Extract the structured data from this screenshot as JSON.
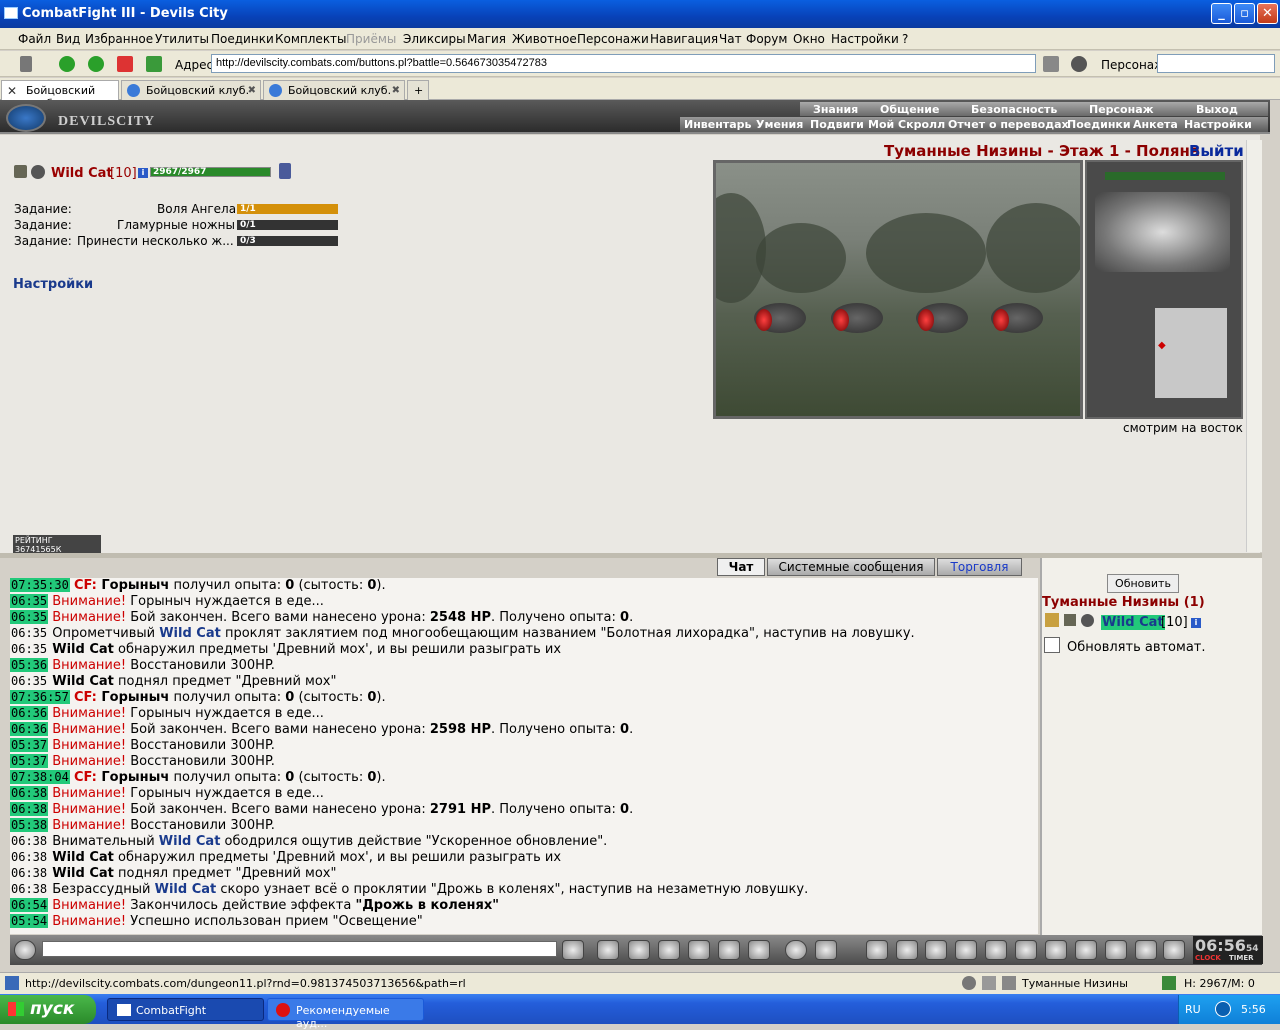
{
  "window": {
    "title": "CombatFight III - Devils City"
  },
  "menu": [
    "Файл",
    "Вид",
    "Избранное",
    "Утилиты",
    "Поединки",
    "Комплекты",
    "Приёмы",
    "Эликсиры",
    "Магия",
    "Животное",
    "Персонажи",
    "Навигация",
    "Чат",
    "Форум",
    "Окно",
    "Настройки",
    "?"
  ],
  "address": {
    "label": "Адрес:",
    "url": "http://devilscity.combats.com/buttons.pl?battle=0.564673035472783",
    "persona_label": "Персонаж:"
  },
  "tabs": [
    {
      "label": "Бойцовский клуб"
    },
    {
      "label": "Бойцовский клуб."
    },
    {
      "label": "Бойцовский клуб."
    }
  ],
  "game_header": {
    "logo": "DEVILSCITY",
    "nav_top": [
      "Знания",
      "Общение",
      "Безопасность",
      "Персонаж",
      "Выход"
    ],
    "nav_bottom": [
      "Инвентарь",
      "Умения",
      "Подвиги",
      "Мой Скролл",
      "Отчет о переводах",
      "Поединки",
      "Анкета",
      "Настройки"
    ]
  },
  "character": {
    "name": "Wild Cat",
    "level": "[10]",
    "hp": "2967/2967",
    "hp_fraction": 1.0
  },
  "quests": [
    {
      "label": "Задание:",
      "name": "Воля Ангела",
      "progress": "1/1",
      "fraction": 1.0
    },
    {
      "label": "Задание:",
      "name": "Гламурные ножны",
      "progress": "0/1",
      "fraction": 0
    },
    {
      "label": "Задание:",
      "name": "Принести несколько ж...",
      "progress": "0/3",
      "fraction": 0
    }
  ],
  "settings_link": "Настройки",
  "location": {
    "title": "Туманные Низины - Этаж 1 - Поляна",
    "exit": "Выйти",
    "facing": "смотрим на восток"
  },
  "rating": "РЕЙТИНГ 36741565К",
  "chat_tabs": [
    "Чат",
    "Системные сообщения",
    "Торговля"
  ],
  "chat": [
    {
      "ts": "07:35:30",
      "hl": true,
      "parts": [
        [
          "cf",
          "CF:"
        ],
        [
          "b",
          " Горыныч"
        ],
        [
          "",
          "",
          " получил опыта: "
        ],
        [
          "b",
          "0"
        ],
        [
          "",
          " (сытость: "
        ],
        [
          "b",
          "0"
        ],
        [
          "",
          "). "
        ]
      ]
    },
    {
      "ts": "06:35",
      "hl": true,
      "parts": [
        [
          "warn",
          "Внимание!"
        ],
        [
          "",
          " Горыныч нуждается в еде..."
        ]
      ]
    },
    {
      "ts": "06:35",
      "hl": true,
      "parts": [
        [
          "warn",
          "Внимание!"
        ],
        [
          "",
          " Бой закончен. Всего вами нанесено урона: "
        ],
        [
          "b",
          "2548 HP"
        ],
        [
          "",
          ". Получено опыта: "
        ],
        [
          "b",
          "0"
        ],
        [
          "",
          "."
        ]
      ]
    },
    {
      "ts": "06:35",
      "hl": false,
      "parts": [
        [
          "",
          "Опрометчивый "
        ],
        [
          "nm",
          "Wild Cat"
        ],
        [
          "",
          " проклят заклятием под многообещающим названием \"Болотная лихорадка\", наступив на ловушку."
        ]
      ]
    },
    {
      "ts": "06:35",
      "hl": false,
      "parts": [
        [
          "b",
          "Wild Cat"
        ],
        [
          "",
          " обнаружил предметы 'Древний мох', и вы решили разыграть их"
        ]
      ]
    },
    {
      "ts": "05:36",
      "hl": true,
      "parts": [
        [
          "warn",
          "Внимание!"
        ],
        [
          "",
          " Восстановили 300HP."
        ]
      ]
    },
    {
      "ts": "06:35",
      "hl": false,
      "parts": [
        [
          "b",
          "Wild Cat"
        ],
        [
          "",
          " поднял предмет \"Древний мох\""
        ]
      ]
    },
    {
      "ts": "07:36:57",
      "hl": true,
      "parts": [
        [
          "cf",
          "CF:"
        ],
        [
          "b",
          " Горыныч"
        ],
        [
          "",
          " получил опыта: "
        ],
        [
          "b",
          "0"
        ],
        [
          "",
          " (сытость: "
        ],
        [
          "b",
          "0"
        ],
        [
          "",
          "). "
        ]
      ]
    },
    {
      "ts": "06:36",
      "hl": true,
      "parts": [
        [
          "warn",
          "Внимание!"
        ],
        [
          "",
          " Горыныч нуждается в еде..."
        ]
      ]
    },
    {
      "ts": "06:36",
      "hl": true,
      "parts": [
        [
          "warn",
          "Внимание!"
        ],
        [
          "",
          " Бой закончен. Всего вами нанесено урона: "
        ],
        [
          "b",
          "2598 HP"
        ],
        [
          "",
          ". Получено опыта: "
        ],
        [
          "b",
          "0"
        ],
        [
          "",
          "."
        ]
      ]
    },
    {
      "ts": "05:37",
      "hl": true,
      "parts": [
        [
          "warn",
          "Внимание!"
        ],
        [
          "",
          " Восстановили 300HP."
        ]
      ]
    },
    {
      "ts": "05:37",
      "hl": true,
      "parts": [
        [
          "warn",
          "Внимание!"
        ],
        [
          "",
          " Восстановили 300HP."
        ]
      ]
    },
    {
      "ts": "07:38:04",
      "hl": true,
      "parts": [
        [
          "cf",
          "CF:"
        ],
        [
          "b",
          " Горыныч"
        ],
        [
          "",
          " получил опыта: "
        ],
        [
          "b",
          "0"
        ],
        [
          "",
          " (сытость: "
        ],
        [
          "b",
          "0"
        ],
        [
          "",
          "). "
        ]
      ]
    },
    {
      "ts": "06:38",
      "hl": true,
      "parts": [
        [
          "warn",
          "Внимание!"
        ],
        [
          "",
          " Горыныч нуждается в еде..."
        ]
      ]
    },
    {
      "ts": "06:38",
      "hl": true,
      "parts": [
        [
          "warn",
          "Внимание!"
        ],
        [
          "",
          " Бой закончен. Всего вами нанесено урона: "
        ],
        [
          "b",
          "2791 HP"
        ],
        [
          "",
          ". Получено опыта: "
        ],
        [
          "b",
          "0"
        ],
        [
          "",
          "."
        ]
      ]
    },
    {
      "ts": "05:38",
      "hl": true,
      "parts": [
        [
          "warn",
          "Внимание!"
        ],
        [
          "",
          " Восстановили 300HP."
        ]
      ]
    },
    {
      "ts": "06:38",
      "hl": false,
      "parts": [
        [
          "",
          "Внимательный "
        ],
        [
          "nm",
          "Wild Cat"
        ],
        [
          "",
          " ободрился ощутив действие \"Ускоренное обновление\"."
        ]
      ]
    },
    {
      "ts": "06:38",
      "hl": false,
      "parts": [
        [
          "b",
          "Wild Cat"
        ],
        [
          "",
          " обнаружил предметы 'Древний мох', и вы решили разыграть их"
        ]
      ]
    },
    {
      "ts": "06:38",
      "hl": false,
      "parts": [
        [
          "b",
          "Wild Cat"
        ],
        [
          "",
          " поднял предмет \"Древний мох\""
        ]
      ]
    },
    {
      "ts": "06:38",
      "hl": false,
      "parts": [
        [
          "",
          "Безрассудный "
        ],
        [
          "nm",
          "Wild Cat"
        ],
        [
          "",
          " скоро узнает всё о проклятии \"Дрожь в коленях\", наступив на незаметную ловушку."
        ]
      ]
    },
    {
      "ts": "06:54",
      "hl": true,
      "parts": [
        [
          "warn",
          "Внимание!"
        ],
        [
          "",
          " Закончилось действие эффекта "
        ],
        [
          "b",
          "\"Дрожь в коленях\""
        ]
      ]
    },
    {
      "ts": "05:54",
      "hl": true,
      "parts": [
        [
          "warn",
          "Внимание!"
        ],
        [
          "",
          " Успешно использован прием \"Освещение\""
        ]
      ]
    }
  ],
  "online": {
    "refresh": "Обновить",
    "location": "Туманные Низины (1)",
    "name": "Wild Cat",
    "level": "[10]",
    "auto_label": "Обновлять автомат."
  },
  "clock": {
    "time": "06:56",
    "sec": "54",
    "clock_label": "CLOCK",
    "timer_label": "TIMER"
  },
  "statusbar": {
    "url": "http://devilscity.combats.com/dungeon11.pl?rnd=0.981374503713656&path=rl",
    "location": "Туманные Низины",
    "hp": "Н: 2967/М: 0"
  },
  "taskbar": {
    "start": "пуск",
    "tasks": [
      "CombatFight",
      "Рекомендуемые ауд..."
    ],
    "lang": "RU",
    "time": "5:56"
  },
  "colors": {
    "accent_red": "#8c0000",
    "link_blue": "#1a3a8c",
    "timestamp_green": "#22c97a"
  }
}
